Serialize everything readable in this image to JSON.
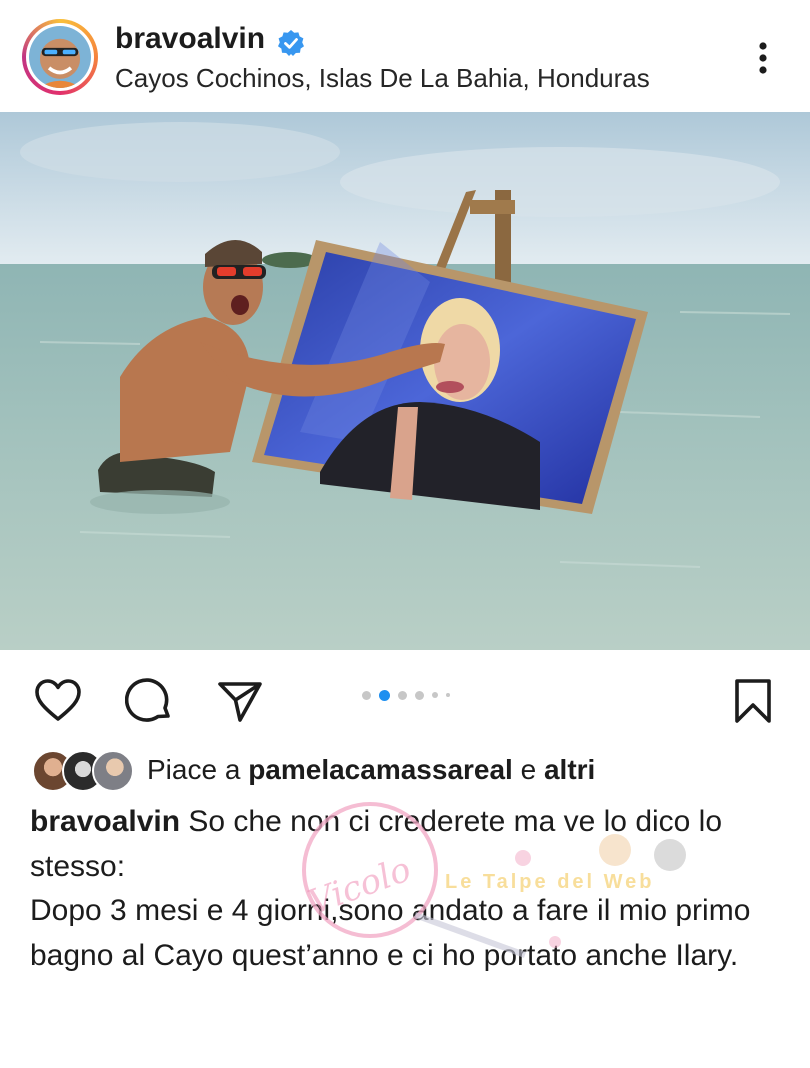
{
  "header": {
    "username": "bravoalvin",
    "location": "Cayos Cochinos, Islas De La Bahia, Honduras",
    "verified_icon": "verified-badge-icon",
    "more_icon": "more-vertical-icon"
  },
  "post": {
    "carousel": {
      "total": 6,
      "active_index": 1
    }
  },
  "actions": {
    "like_icon": "heart-icon",
    "comment_icon": "comment-icon",
    "share_icon": "send-icon",
    "save_icon": "bookmark-icon"
  },
  "likes": {
    "prefix": "Piace a",
    "user": "pamelacamassareal",
    "joiner": "e",
    "others": "altri"
  },
  "caption": {
    "username": "bravoalvin",
    "line1": "So che non ci crederete ma ve lo dico lo stesso:",
    "line2": "Dopo 3 mesi e 4 giorni,sono andato a fare il mio primo bagno al Cayo quest’anno e ci ho portato anche Ilary."
  },
  "watermark": {
    "left_text": "Vicolo delle News",
    "right_text": "Le Talpe del Web"
  },
  "colors": {
    "accent_blue": "#1d8ff0",
    "verified_blue": "#3897f0",
    "text": "#1c1c1c"
  }
}
